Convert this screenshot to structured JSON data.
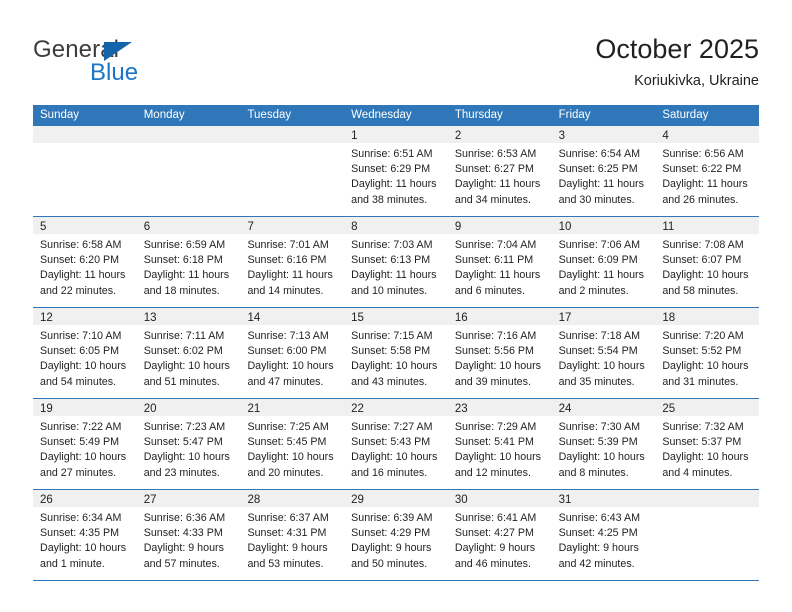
{
  "brand": {
    "name_top": "General",
    "name_bottom": "Blue",
    "color_dark": "#3c3c3b",
    "color_blue": "#1b76c4"
  },
  "header": {
    "title": "October 2025",
    "subtitle": "Koriukivka, Ukraine"
  },
  "theme": {
    "header_bar": "#2f77b8",
    "daynum_band": "#f0f0f0",
    "text": "#221f1f"
  },
  "weekdays": [
    "Sunday",
    "Monday",
    "Tuesday",
    "Wednesday",
    "Thursday",
    "Friday",
    "Saturday"
  ],
  "weeks": [
    [
      {
        "day": "",
        "lines": []
      },
      {
        "day": "",
        "lines": []
      },
      {
        "day": "",
        "lines": []
      },
      {
        "day": "1",
        "lines": [
          "Sunrise: 6:51 AM",
          "Sunset: 6:29 PM",
          "Daylight: 11 hours",
          "and 38 minutes."
        ]
      },
      {
        "day": "2",
        "lines": [
          "Sunrise: 6:53 AM",
          "Sunset: 6:27 PM",
          "Daylight: 11 hours",
          "and 34 minutes."
        ]
      },
      {
        "day": "3",
        "lines": [
          "Sunrise: 6:54 AM",
          "Sunset: 6:25 PM",
          "Daylight: 11 hours",
          "and 30 minutes."
        ]
      },
      {
        "day": "4",
        "lines": [
          "Sunrise: 6:56 AM",
          "Sunset: 6:22 PM",
          "Daylight: 11 hours",
          "and 26 minutes."
        ]
      }
    ],
    [
      {
        "day": "5",
        "lines": [
          "Sunrise: 6:58 AM",
          "Sunset: 6:20 PM",
          "Daylight: 11 hours",
          "and 22 minutes."
        ]
      },
      {
        "day": "6",
        "lines": [
          "Sunrise: 6:59 AM",
          "Sunset: 6:18 PM",
          "Daylight: 11 hours",
          "and 18 minutes."
        ]
      },
      {
        "day": "7",
        "lines": [
          "Sunrise: 7:01 AM",
          "Sunset: 6:16 PM",
          "Daylight: 11 hours",
          "and 14 minutes."
        ]
      },
      {
        "day": "8",
        "lines": [
          "Sunrise: 7:03 AM",
          "Sunset: 6:13 PM",
          "Daylight: 11 hours",
          "and 10 minutes."
        ]
      },
      {
        "day": "9",
        "lines": [
          "Sunrise: 7:04 AM",
          "Sunset: 6:11 PM",
          "Daylight: 11 hours",
          "and 6 minutes."
        ]
      },
      {
        "day": "10",
        "lines": [
          "Sunrise: 7:06 AM",
          "Sunset: 6:09 PM",
          "Daylight: 11 hours",
          "and 2 minutes."
        ]
      },
      {
        "day": "11",
        "lines": [
          "Sunrise: 7:08 AM",
          "Sunset: 6:07 PM",
          "Daylight: 10 hours",
          "and 58 minutes."
        ]
      }
    ],
    [
      {
        "day": "12",
        "lines": [
          "Sunrise: 7:10 AM",
          "Sunset: 6:05 PM",
          "Daylight: 10 hours",
          "and 54 minutes."
        ]
      },
      {
        "day": "13",
        "lines": [
          "Sunrise: 7:11 AM",
          "Sunset: 6:02 PM",
          "Daylight: 10 hours",
          "and 51 minutes."
        ]
      },
      {
        "day": "14",
        "lines": [
          "Sunrise: 7:13 AM",
          "Sunset: 6:00 PM",
          "Daylight: 10 hours",
          "and 47 minutes."
        ]
      },
      {
        "day": "15",
        "lines": [
          "Sunrise: 7:15 AM",
          "Sunset: 5:58 PM",
          "Daylight: 10 hours",
          "and 43 minutes."
        ]
      },
      {
        "day": "16",
        "lines": [
          "Sunrise: 7:16 AM",
          "Sunset: 5:56 PM",
          "Daylight: 10 hours",
          "and 39 minutes."
        ]
      },
      {
        "day": "17",
        "lines": [
          "Sunrise: 7:18 AM",
          "Sunset: 5:54 PM",
          "Daylight: 10 hours",
          "and 35 minutes."
        ]
      },
      {
        "day": "18",
        "lines": [
          "Sunrise: 7:20 AM",
          "Sunset: 5:52 PM",
          "Daylight: 10 hours",
          "and 31 minutes."
        ]
      }
    ],
    [
      {
        "day": "19",
        "lines": [
          "Sunrise: 7:22 AM",
          "Sunset: 5:49 PM",
          "Daylight: 10 hours",
          "and 27 minutes."
        ]
      },
      {
        "day": "20",
        "lines": [
          "Sunrise: 7:23 AM",
          "Sunset: 5:47 PM",
          "Daylight: 10 hours",
          "and 23 minutes."
        ]
      },
      {
        "day": "21",
        "lines": [
          "Sunrise: 7:25 AM",
          "Sunset: 5:45 PM",
          "Daylight: 10 hours",
          "and 20 minutes."
        ]
      },
      {
        "day": "22",
        "lines": [
          "Sunrise: 7:27 AM",
          "Sunset: 5:43 PM",
          "Daylight: 10 hours",
          "and 16 minutes."
        ]
      },
      {
        "day": "23",
        "lines": [
          "Sunrise: 7:29 AM",
          "Sunset: 5:41 PM",
          "Daylight: 10 hours",
          "and 12 minutes."
        ]
      },
      {
        "day": "24",
        "lines": [
          "Sunrise: 7:30 AM",
          "Sunset: 5:39 PM",
          "Daylight: 10 hours",
          "and 8 minutes."
        ]
      },
      {
        "day": "25",
        "lines": [
          "Sunrise: 7:32 AM",
          "Sunset: 5:37 PM",
          "Daylight: 10 hours",
          "and 4 minutes."
        ]
      }
    ],
    [
      {
        "day": "26",
        "lines": [
          "Sunrise: 6:34 AM",
          "Sunset: 4:35 PM",
          "Daylight: 10 hours",
          "and 1 minute."
        ]
      },
      {
        "day": "27",
        "lines": [
          "Sunrise: 6:36 AM",
          "Sunset: 4:33 PM",
          "Daylight: 9 hours",
          "and 57 minutes."
        ]
      },
      {
        "day": "28",
        "lines": [
          "Sunrise: 6:37 AM",
          "Sunset: 4:31 PM",
          "Daylight: 9 hours",
          "and 53 minutes."
        ]
      },
      {
        "day": "29",
        "lines": [
          "Sunrise: 6:39 AM",
          "Sunset: 4:29 PM",
          "Daylight: 9 hours",
          "and 50 minutes."
        ]
      },
      {
        "day": "30",
        "lines": [
          "Sunrise: 6:41 AM",
          "Sunset: 4:27 PM",
          "Daylight: 9 hours",
          "and 46 minutes."
        ]
      },
      {
        "day": "31",
        "lines": [
          "Sunrise: 6:43 AM",
          "Sunset: 4:25 PM",
          "Daylight: 9 hours",
          "and 42 minutes."
        ]
      },
      {
        "day": "",
        "lines": []
      }
    ]
  ]
}
